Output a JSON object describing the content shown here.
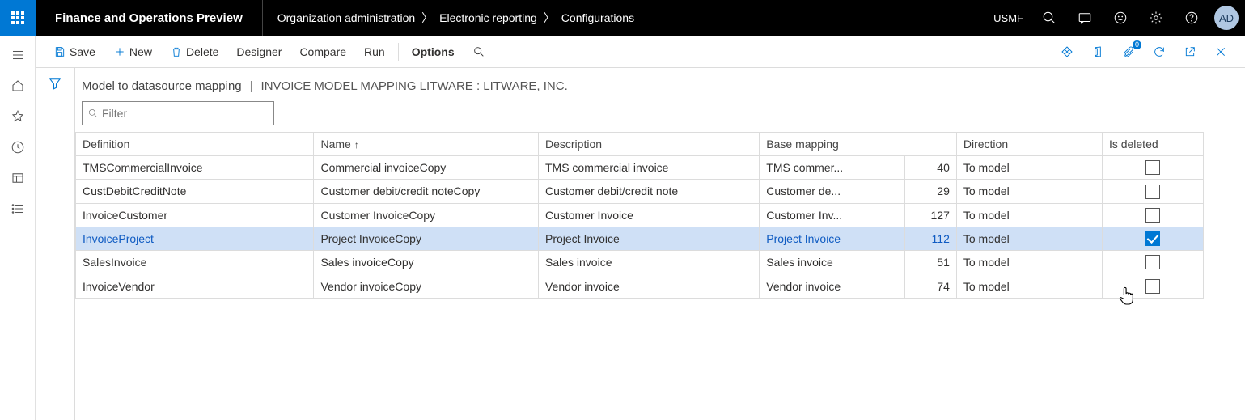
{
  "header": {
    "app_title": "Finance and Operations Preview",
    "breadcrumb": [
      "Organization administration",
      "Electronic reporting",
      "Configurations"
    ],
    "company": "USMF",
    "avatar": "AD"
  },
  "actionbar": {
    "save": "Save",
    "new": "New",
    "delete": "Delete",
    "designer": "Designer",
    "compare": "Compare",
    "run": "Run",
    "options": "Options",
    "attachment_badge": "0"
  },
  "title": {
    "main": "Model to datasource mapping",
    "sub": "INVOICE MODEL MAPPING LITWARE : LITWARE, INC."
  },
  "filter_placeholder": "Filter",
  "columns": {
    "definition": "Definition",
    "name": "Name",
    "description": "Description",
    "base_mapping": "Base mapping",
    "direction": "Direction",
    "is_deleted": "Is deleted"
  },
  "rows": [
    {
      "definition": "TMSCommercialInvoice",
      "name": "Commercial invoiceCopy",
      "description": "TMS commercial invoice",
      "base_mapping": "TMS commer...",
      "count": 40,
      "direction": "To model",
      "is_deleted": false,
      "selected": false
    },
    {
      "definition": "CustDebitCreditNote",
      "name": "Customer debit/credit noteCopy",
      "description": "Customer debit/credit note",
      "base_mapping": "Customer de...",
      "count": 29,
      "direction": "To model",
      "is_deleted": false,
      "selected": false
    },
    {
      "definition": "InvoiceCustomer",
      "name": "Customer InvoiceCopy",
      "description": "Customer Invoice",
      "base_mapping": "Customer Inv...",
      "count": 127,
      "direction": "To model",
      "is_deleted": false,
      "selected": false
    },
    {
      "definition": "InvoiceProject",
      "name": "Project InvoiceCopy",
      "description": "Project Invoice",
      "base_mapping": "Project Invoice",
      "count": 112,
      "direction": "To model",
      "is_deleted": true,
      "selected": true
    },
    {
      "definition": "SalesInvoice",
      "name": "Sales invoiceCopy",
      "description": "Sales invoice",
      "base_mapping": "Sales invoice",
      "count": 51,
      "direction": "To model",
      "is_deleted": false,
      "selected": false
    },
    {
      "definition": "InvoiceVendor",
      "name": "Vendor invoiceCopy",
      "description": "Vendor invoice",
      "base_mapping": "Vendor invoice",
      "count": 74,
      "direction": "To model",
      "is_deleted": false,
      "selected": false
    }
  ]
}
